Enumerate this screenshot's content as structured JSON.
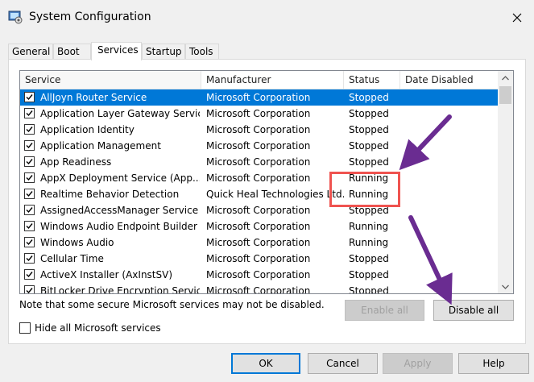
{
  "window": {
    "title": "System Configuration",
    "icon": "msconfig-icon",
    "close_icon": "close-icon"
  },
  "tabs": [
    {
      "label": "General",
      "active": false
    },
    {
      "label": "Boot",
      "active": false
    },
    {
      "label": "Services",
      "active": true
    },
    {
      "label": "Startup",
      "active": false
    },
    {
      "label": "Tools",
      "active": false
    }
  ],
  "table": {
    "columns": [
      "Service",
      "Manufacturer",
      "Status",
      "Date Disabled"
    ],
    "rows": [
      {
        "checked": true,
        "service": "AllJoyn Router Service",
        "manufacturer": "Microsoft Corporation",
        "status": "Stopped",
        "date_disabled": "",
        "selected": true
      },
      {
        "checked": true,
        "service": "Application Layer Gateway Service",
        "manufacturer": "Microsoft Corporation",
        "status": "Stopped",
        "date_disabled": ""
      },
      {
        "checked": true,
        "service": "Application Identity",
        "manufacturer": "Microsoft Corporation",
        "status": "Stopped",
        "date_disabled": ""
      },
      {
        "checked": true,
        "service": "Application Management",
        "manufacturer": "Microsoft Corporation",
        "status": "Stopped",
        "date_disabled": ""
      },
      {
        "checked": true,
        "service": "App Readiness",
        "manufacturer": "Microsoft Corporation",
        "status": "Stopped",
        "date_disabled": ""
      },
      {
        "checked": true,
        "service": "AppX Deployment Service (App...",
        "manufacturer": "Microsoft Corporation",
        "status": "Running",
        "date_disabled": ""
      },
      {
        "checked": true,
        "service": "Realtime Behavior Detection",
        "manufacturer": "Quick Heal Technologies Ltd.",
        "status": "Running",
        "date_disabled": ""
      },
      {
        "checked": true,
        "service": "AssignedAccessManager Service",
        "manufacturer": "Microsoft Corporation",
        "status": "Stopped",
        "date_disabled": ""
      },
      {
        "checked": true,
        "service": "Windows Audio Endpoint Builder",
        "manufacturer": "Microsoft Corporation",
        "status": "Running",
        "date_disabled": ""
      },
      {
        "checked": true,
        "service": "Windows Audio",
        "manufacturer": "Microsoft Corporation",
        "status": "Running",
        "date_disabled": ""
      },
      {
        "checked": true,
        "service": "Cellular Time",
        "manufacturer": "Microsoft Corporation",
        "status": "Stopped",
        "date_disabled": ""
      },
      {
        "checked": true,
        "service": "ActiveX Installer (AxInstSV)",
        "manufacturer": "Microsoft Corporation",
        "status": "Stopped",
        "date_disabled": ""
      },
      {
        "checked": true,
        "service": "BitLocker Drive Encryption Service",
        "manufacturer": "Microsoft Corporation",
        "status": "Stopped",
        "date_disabled": ""
      }
    ]
  },
  "note": "Note that some secure Microsoft services may not be disabled.",
  "enable_all": "Enable all",
  "disable_all": "Disable all",
  "hide_ms_label": "Hide all Microsoft services",
  "footer": {
    "ok": "OK",
    "cancel": "Cancel",
    "apply": "Apply",
    "help": "Help"
  },
  "colors": {
    "selection": "#0078d7",
    "highlight": "#ef5350",
    "arrow": "#6a2c91"
  }
}
